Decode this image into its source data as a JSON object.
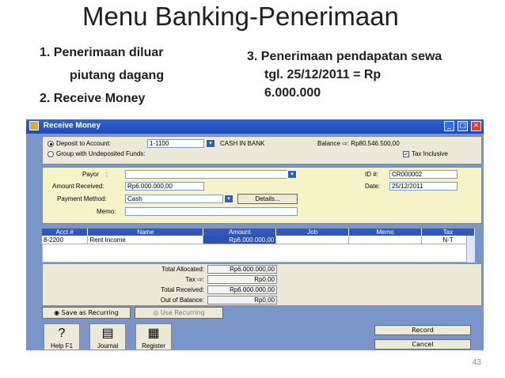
{
  "slide": {
    "title": "Menu Banking-Penerimaan",
    "items_left": [
      "1.   Penerimaan diluar",
      "piutang dagang",
      "2.   Receive Money"
    ],
    "items_right": [
      "3.  Penerimaan pendapatan sewa",
      "tgl. 25/12/2011 = Rp",
      "6.000.000"
    ],
    "page_number": "43"
  },
  "window": {
    "title": "Receive Money",
    "deposit_label": "Deposit to Account:",
    "deposit_account": "1-1100",
    "deposit_account_name": "CASH IN BANK",
    "group_label": "Group with Undeposited Funds:",
    "balance_label": "Balance",
    "balance_value": "Rp80.546.500,00",
    "tax_inclusive_label": "Tax Inclusive",
    "payor_label": "Payor",
    "amount_received_label": "Amount Received:",
    "amount_received_value": "Rp6.000.000,00",
    "payment_method_label": "Payment Method:",
    "payment_method_value": "Cash",
    "details_button": "Details...",
    "memo_label": "Memo:",
    "id_label": "ID #:",
    "id_value": "CR000002",
    "date_label": "Date:",
    "date_value": "25/12/2011",
    "grid_headers": [
      "Acct #",
      "Name",
      "Amount",
      "Job",
      "Memo",
      "Tax"
    ],
    "grid_rows": [
      {
        "acct": "8-2200",
        "name": "Rent Income",
        "amount": "Rp6.000.000,00",
        "job": "",
        "memo": "",
        "tax": "N-T"
      }
    ],
    "totals": [
      {
        "label": "Total Allocated:",
        "value": "Rp6.000.000,00"
      },
      {
        "label": "Tax",
        "value": "Rp0,00"
      },
      {
        "label": "Total Received:",
        "value": "Rp6.000.000,00"
      },
      {
        "label": "Out of Balance:",
        "value": "Rp0,00"
      }
    ],
    "save_recurring": "Save as Recurring",
    "use_recurring": "Use Recurring",
    "record_button": "Record",
    "cancel_button": "Cancel",
    "tools": [
      "Help F1",
      "Journal",
      "Register"
    ]
  }
}
